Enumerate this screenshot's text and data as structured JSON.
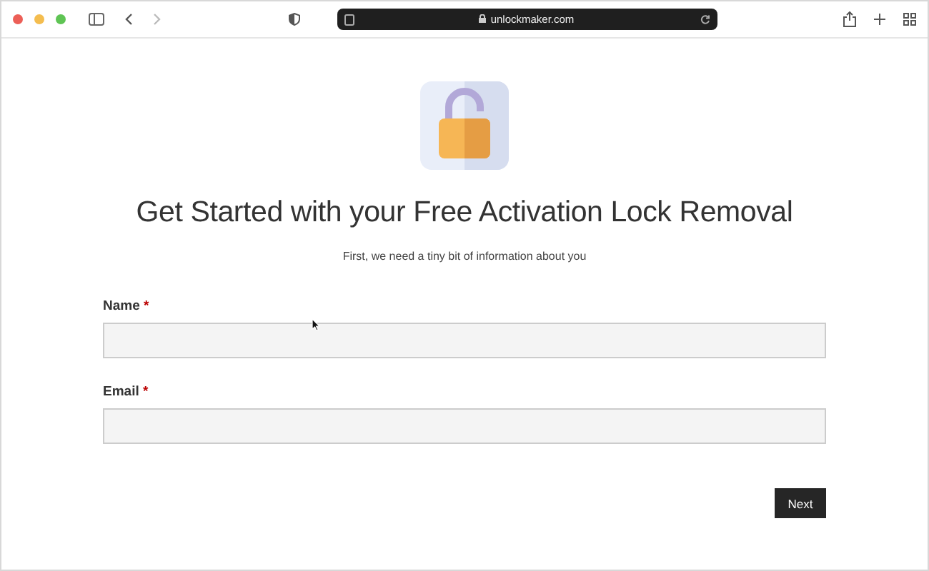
{
  "browser": {
    "url": "unlockmaker.com"
  },
  "heading": "Get Started with your Free Activation Lock Removal",
  "subheading": "First, we need a tiny bit of information about you",
  "fields": [
    {
      "label": "Name",
      "required_mark": "*"
    },
    {
      "label": "Email",
      "required_mark": "*"
    }
  ],
  "submit_button": "Next"
}
